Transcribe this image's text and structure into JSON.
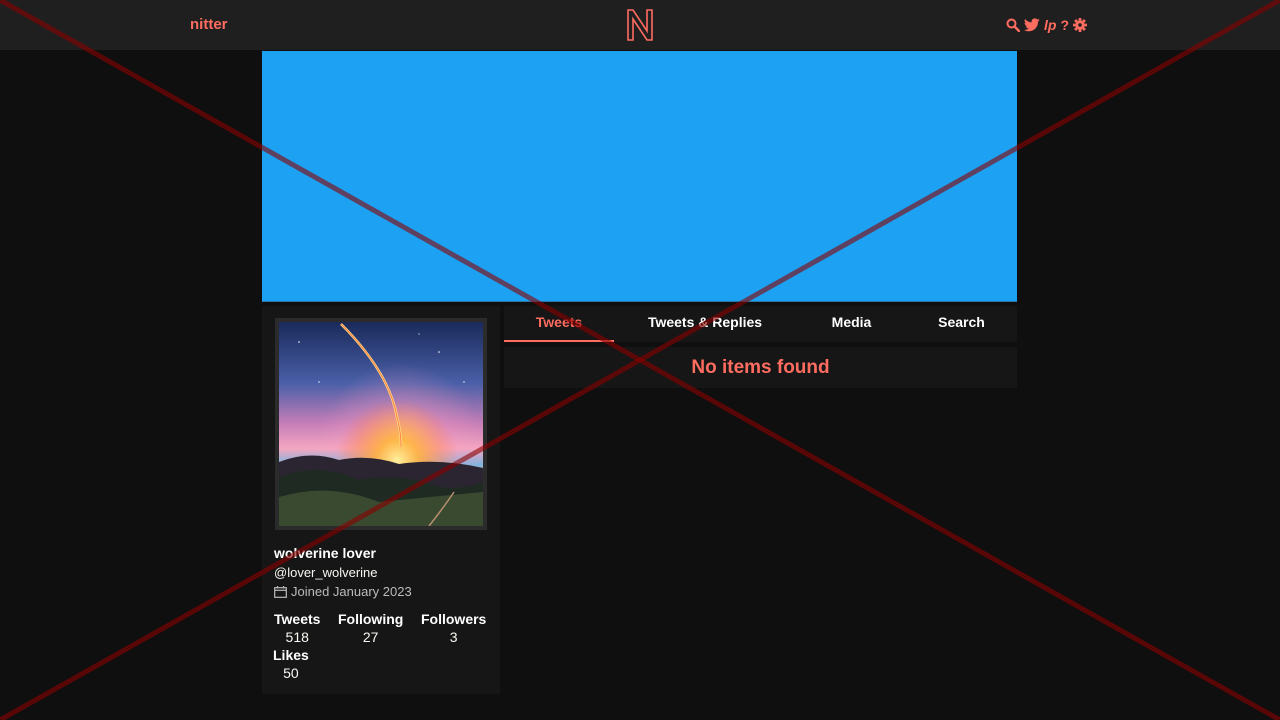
{
  "navbar": {
    "brand": "nitter",
    "logo_letter": "N",
    "icons": [
      "search-icon",
      "twitter-bird-icon",
      "lp-icon",
      "help-icon",
      "gear-icon"
    ],
    "lp_text": "lp",
    "help_text": "?"
  },
  "banner": {
    "color": "#1da1f2"
  },
  "profile": {
    "fullname": "wolverine lover",
    "username": "@lover_wolverine",
    "joined": "Joined January 2023",
    "stats": {
      "tweets_label": "Tweets",
      "tweets_value": "518",
      "following_label": "Following",
      "following_value": "27",
      "followers_label": "Followers",
      "followers_value": "3",
      "likes_label": "Likes",
      "likes_value": "50"
    }
  },
  "tabs": [
    {
      "label": "Tweets",
      "active": true
    },
    {
      "label": "Tweets & Replies",
      "active": false
    },
    {
      "label": "Media",
      "active": false
    },
    {
      "label": "Search",
      "active": false
    }
  ],
  "timeline": {
    "empty_message": "No items found"
  },
  "colors": {
    "accent": "#ff6c60",
    "background": "#0f0f0f",
    "panel": "#161616",
    "navbar": "#1f1f1f",
    "overlay_cross": "#8b0000"
  }
}
